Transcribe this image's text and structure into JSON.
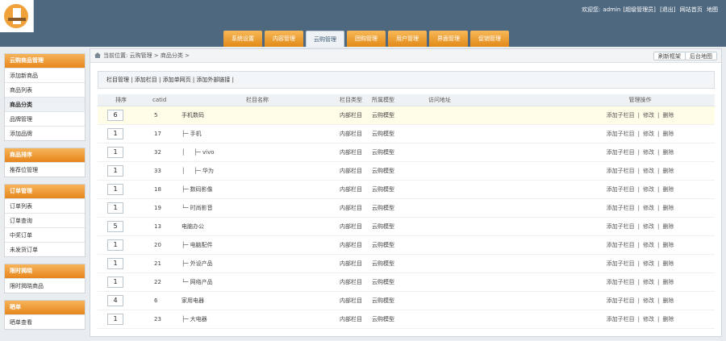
{
  "header": {
    "welcome": "欢迎您:",
    "user": "admin",
    "role": "[超级管理员]",
    "logout": "[退出]",
    "home": "网站首页",
    "map": "地图"
  },
  "nav": [
    "系统设置",
    "内容管理",
    "云购管理",
    "团购管理",
    "用户管理",
    "界面管理",
    "促销管理"
  ],
  "nav_active_index": 2,
  "sidebar": [
    {
      "title": "云购商品管理",
      "items": [
        "添加新商品",
        "商品列表",
        "商品分类",
        "品牌管理",
        "添加品牌"
      ],
      "active": 2
    },
    {
      "title": "商品排序",
      "items": [
        "推荐位管理"
      ],
      "active": -1
    },
    {
      "title": "订单管理",
      "items": [
        "订单列表",
        "订单查询",
        "中奖订单",
        "未发货订单"
      ],
      "active": -1
    },
    {
      "title": "限时揭晓",
      "items": [
        "限时揭晓商品"
      ],
      "active": -1
    },
    {
      "title": "晒单",
      "items": [
        "晒单查看"
      ],
      "active": -1
    }
  ],
  "crumb": "当前位置: 云购管理 > 商品分类 >",
  "crumb_buttons": [
    "刷新框架",
    "后台地图"
  ],
  "subnav": "栏目管理 | 添加栏目 | 添加单网页 | 添加外部链接 |",
  "table": {
    "headers": [
      "排序",
      "catid",
      "栏目名称",
      "栏目类型",
      "所属模型",
      "访问地址",
      "管理操作"
    ],
    "rows": [
      {
        "sort": "6",
        "catid": "5",
        "name": "手机数码",
        "type": "内部栏目",
        "model": "云购模型"
      },
      {
        "sort": "1",
        "catid": "17",
        "name": "├─ 手机",
        "type": "内部栏目",
        "model": "云购模型"
      },
      {
        "sort": "1",
        "catid": "32",
        "name": "│     ├─ vivo",
        "type": "内部栏目",
        "model": "云购模型"
      },
      {
        "sort": "1",
        "catid": "33",
        "name": "│     ├─ 华为",
        "type": "内部栏目",
        "model": "云购模型"
      },
      {
        "sort": "1",
        "catid": "18",
        "name": "├─ 数码影像",
        "type": "内部栏目",
        "model": "云购模型"
      },
      {
        "sort": "1",
        "catid": "19",
        "name": "└─ 时尚影音",
        "type": "内部栏目",
        "model": "云购模型"
      },
      {
        "sort": "5",
        "catid": "13",
        "name": "电脑办公",
        "type": "内部栏目",
        "model": "云购模型"
      },
      {
        "sort": "1",
        "catid": "20",
        "name": "├─ 电脑配件",
        "type": "内部栏目",
        "model": "云购模型"
      },
      {
        "sort": "1",
        "catid": "21",
        "name": "├─ 外设产品",
        "type": "内部栏目",
        "model": "云购模型"
      },
      {
        "sort": "1",
        "catid": "22",
        "name": "└─ 网络产品",
        "type": "内部栏目",
        "model": "云购模型"
      },
      {
        "sort": "4",
        "catid": "6",
        "name": "家用电器",
        "type": "内部栏目",
        "model": "云购模型"
      },
      {
        "sort": "1",
        "catid": "23",
        "name": "├─ 大电器",
        "type": "内部栏目",
        "model": "云购模型"
      }
    ],
    "actions": {
      "add_child": "添加子栏目",
      "sep": "|",
      "edit": "修改",
      "delete": "删除"
    }
  },
  "colors": {
    "header_bg": "#4e6880",
    "accent_orange": "#e7861c",
    "highlight_row": "#fffde8"
  }
}
